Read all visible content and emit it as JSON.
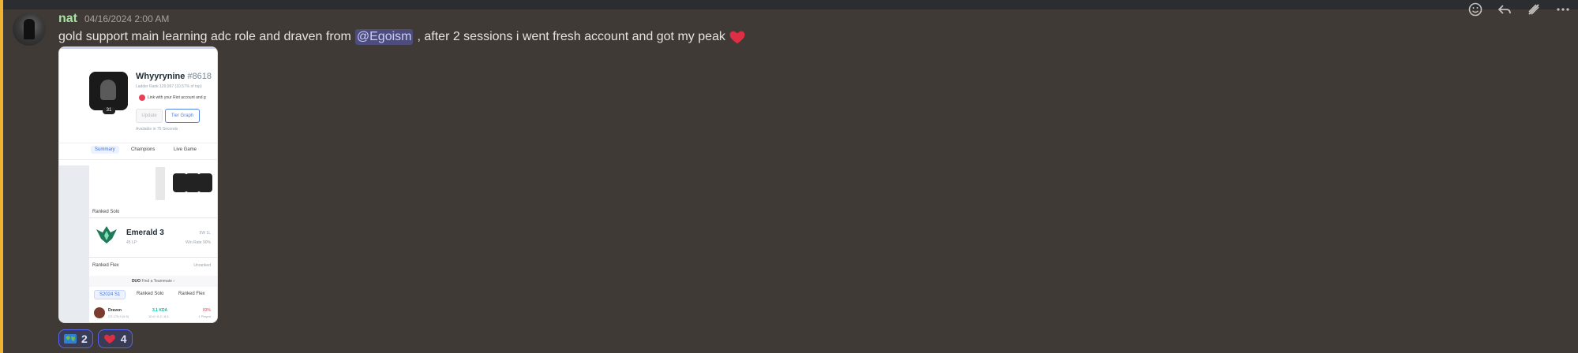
{
  "message": {
    "username": "nat",
    "timestamp": "04/16/2024 2:00 AM",
    "text_before_mention": "gold support main learning adc role and draven from",
    "mention": "@Egoism",
    "text_after_mention": ", after 2 sessions i went fresh account and got my peak",
    "heart_emoji": "heart-icon"
  },
  "attachment": {
    "player_name": "Whyyrynine",
    "player_tag": "#8618",
    "level": "31",
    "ladder_rank": "Ladder Rank 129,997 (10.57% of top)",
    "riot_link_text": "Link with your Riot account and g",
    "update_button": "Update",
    "tier_graph_button": "Tier Graph",
    "available_text": "Available in 75 Seconds",
    "tabs": [
      "Summary",
      "Champions",
      "Live Game"
    ],
    "ranked_solo_label": "Ranked Solo",
    "tier_name": "Emerald 3",
    "lp": "45 LP",
    "win_loss": "9W 1L",
    "win_rate": "Win Rate 90%",
    "ranked_flex_label": "Ranked Flex",
    "unranked": "Unranked",
    "duo_brand": "DUO",
    "duo_text": "Find a Teammate",
    "season_tabs": [
      "S2024 S1",
      "Ranked Solo",
      "Ranked Flex"
    ],
    "champion": {
      "name": "Draven",
      "cs": "CS 179.9 (9.5)",
      "kda": "3.1 KDA",
      "kda_detail": "10.6 / 6.2 / 8.5",
      "win_rate": "83%",
      "played": "1 Played"
    }
  },
  "reactions": [
    {
      "icon": "world-map-icon",
      "count": "2"
    },
    {
      "icon": "heart-icon",
      "count": "4"
    }
  ],
  "toolbar": {
    "icons": [
      "add-reaction-icon",
      "reply-icon",
      "forward-icon",
      "more-options-icon"
    ]
  },
  "colors": {
    "background": "#3f3a36",
    "username": "#a6e3a1",
    "mention_bg": "#4d4c7a",
    "reaction_border": "#5865f2",
    "highlight_bar": "#f0b232"
  }
}
